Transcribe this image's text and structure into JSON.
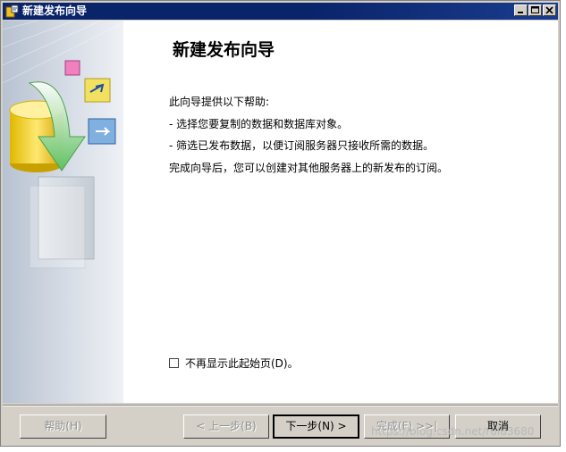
{
  "window": {
    "title": "新建发布向导",
    "title_buttons": [
      "minimize",
      "maximize",
      "close"
    ]
  },
  "page": {
    "heading": "新建发布向导",
    "intro": "此向导提供以下帮助:",
    "bullets": [
      "- 选择您要复制的数据和数据库对象。",
      "- 筛选已发布数据，以便订阅服务器只接收所需的数据。"
    ],
    "outro": "完成向导后，您可以创建对其他服务器上的新发布的订阅。"
  },
  "checkbox": {
    "label": "不再显示此起始页(D)。",
    "checked": false
  },
  "buttons": {
    "help": "帮助(H)",
    "back": "< 上一步(B)",
    "next": "下一步(N) >",
    "finish": "完成(F) >>|",
    "cancel": "取消"
  },
  "watermark": "https://blog.csdn.net/rulu3680",
  "colors": {
    "titlebar": "#0a246a",
    "dialog_bg": "#d4d0c8",
    "content_bg": "#ffffff"
  }
}
